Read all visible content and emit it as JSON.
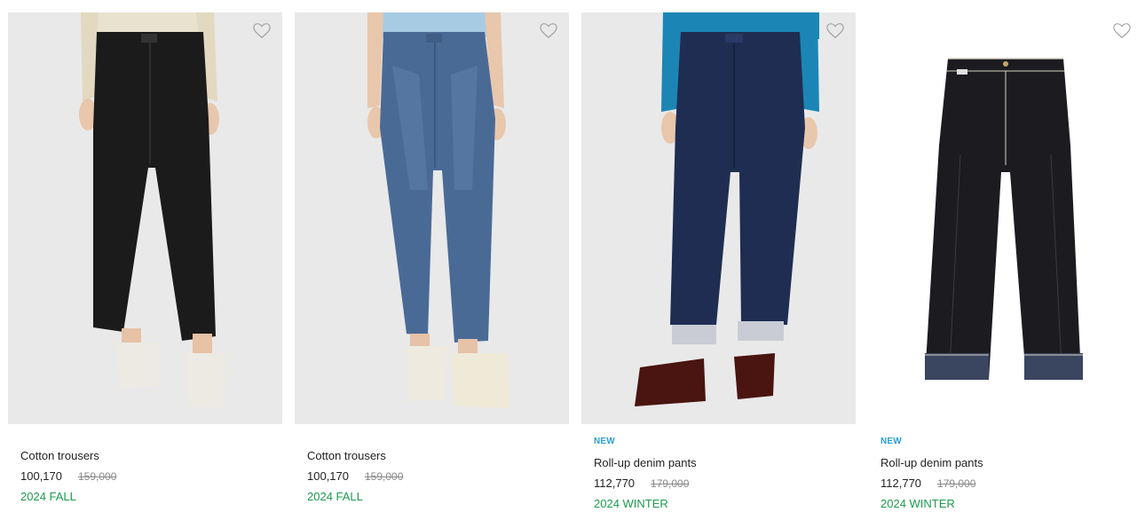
{
  "products": [
    {
      "name": "Cotton trousers",
      "price": "100,170",
      "old_price": "159,000",
      "season": "2024 FALL",
      "badge": "",
      "wishlist_icon": "heart-outline-icon",
      "colors": {
        "pants": "#1b1b1b",
        "top": "#e9e2cf",
        "shoe": "#eceae2"
      }
    },
    {
      "name": "Cotton trousers",
      "price": "100,170",
      "old_price": "159,000",
      "season": "2024 FALL",
      "badge": "",
      "wishlist_icon": "heart-outline-icon",
      "colors": {
        "pants": "#4a6a96",
        "top": "#a8cbe4",
        "shoe": "#eeeadf"
      }
    },
    {
      "name": "Roll-up denim pants",
      "price": "112,770",
      "old_price": "179,000",
      "season": "2024 WINTER",
      "badge": "NEW",
      "wishlist_icon": "heart-outline-icon",
      "colors": {
        "pants": "#1f2d52",
        "top": "#1b86b5",
        "shoe": "#4a1410"
      }
    },
    {
      "name": "Roll-up denim pants",
      "price": "112,770",
      "old_price": "179,000",
      "season": "2024 WINTER",
      "badge": "NEW",
      "wishlist_icon": "heart-outline-icon",
      "colors": {
        "pants": "#1c1c20",
        "cuff": "#3a4560"
      }
    }
  ],
  "theme": {
    "season_color": "#1d9a4e",
    "badge_color": "#2a9fd6",
    "old_price_color": "#8a8a8a"
  }
}
